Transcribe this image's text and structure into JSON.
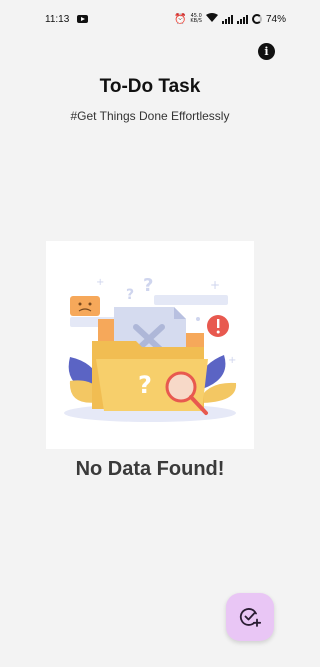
{
  "status_bar": {
    "time": "11:13",
    "speed_top": "45.0",
    "speed_bottom": "KB/S",
    "battery": "74%"
  },
  "header": {
    "title": "To-Do Task",
    "subtitle": "#Get Things Done Effortlessly"
  },
  "empty_state": {
    "message": "No Data Found!"
  },
  "colors": {
    "background": "#f3f3f3",
    "fab_background": "#e9c6f5",
    "folder": "#f7cf6b",
    "accent_red": "#e8594f"
  },
  "icons": {
    "info": "info-icon",
    "fab": "add-task-icon"
  }
}
